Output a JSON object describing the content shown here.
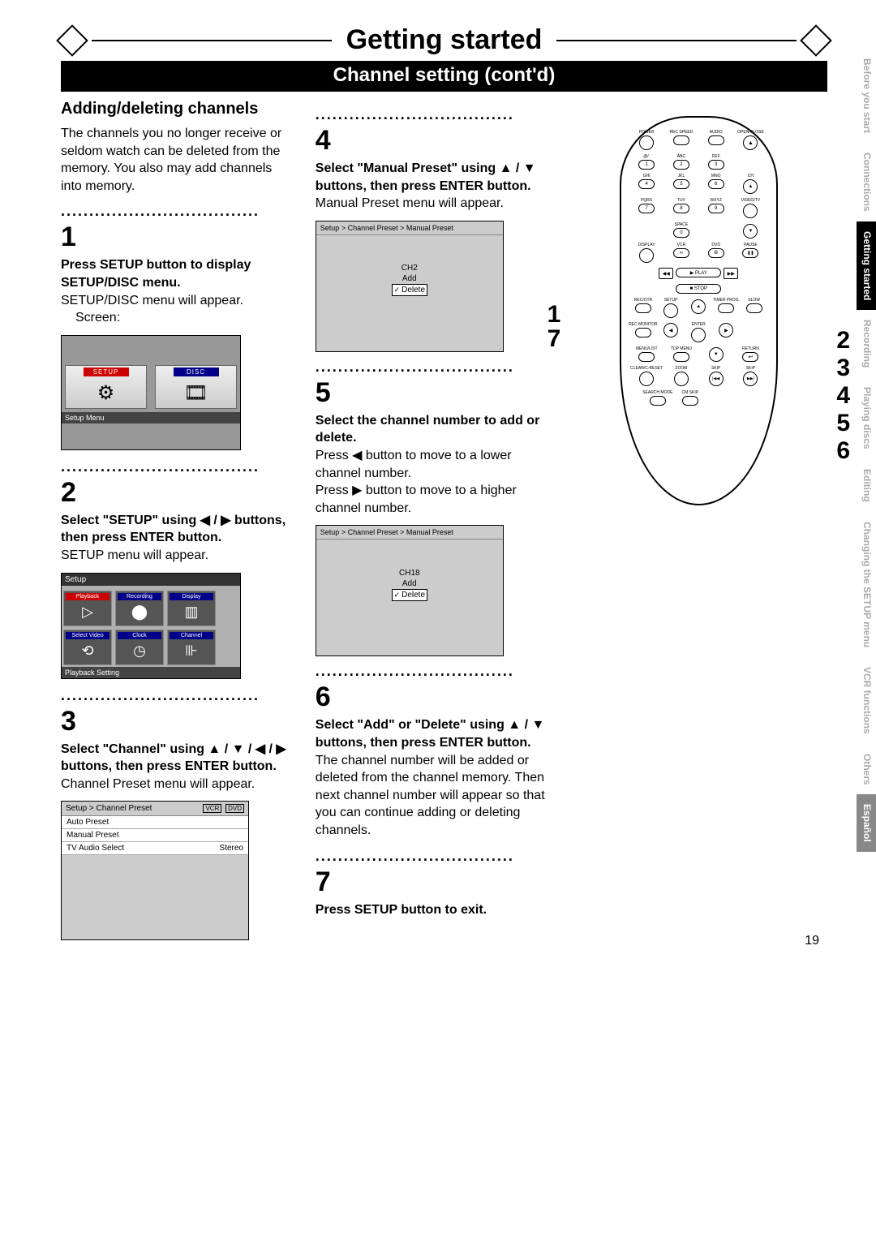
{
  "header": {
    "title": "Getting started",
    "subtitle": "Channel setting (cont'd)"
  },
  "section_heading": "Adding/deleting channels",
  "intro": "The channels you no longer receive or seldom watch can be deleted from the memory. You also may add channels into memory.",
  "dots": "...................................",
  "steps": {
    "s1": {
      "num": "1",
      "bold": "Press SETUP button to display SETUP/DISC menu.",
      "body": "SETUP/DISC menu will appear.",
      "indent": "Screen:"
    },
    "s2": {
      "num": "2",
      "bold": "Select \"SETUP\" using ◀ / ▶ buttons, then press ENTER button.",
      "body": "SETUP menu will appear."
    },
    "s3": {
      "num": "3",
      "bold": "Select \"Channel\" using ▲ / ▼ / ◀ / ▶ buttons, then press ENTER button.",
      "body": "Channel Preset menu will appear."
    },
    "s4": {
      "num": "4",
      "bold": "Select \"Manual Preset\" using ▲ / ▼ buttons, then press ENTER button.",
      "body": "Manual Preset menu will appear."
    },
    "s5": {
      "num": "5",
      "bold": "Select the channel number to add or delete.",
      "body1": "Press ◀ button to move to a lower channel number.",
      "body2": "Press ▶ button to move to a higher channel number."
    },
    "s6": {
      "num": "6",
      "bold": "Select \"Add\" or \"Delete\" using ▲ / ▼ buttons, then press ENTER button.",
      "body": "The channel number will be added or deleted from the channel memory. Then next channel number will appear so that you can continue adding or deleting channels."
    },
    "s7": {
      "num": "7",
      "bold": "Press SETUP button to exit."
    }
  },
  "screens": {
    "setup_disc": {
      "setup_label": "SETUP",
      "disc_label": "DISC",
      "footer": "Setup Menu"
    },
    "setup_menu": {
      "title": "Setup",
      "tiles": [
        "Playback",
        "Recording",
        "Display",
        "Select\nVideo",
        "Clock",
        "Channel"
      ],
      "footer": "Playback Setting"
    },
    "channel_preset": {
      "breadcrumb": "Setup > Channel Preset",
      "tags": [
        "VCR",
        "DVD"
      ],
      "rows": [
        {
          "name": "Auto Preset",
          "val": ""
        },
        {
          "name": "Manual Preset",
          "val": ""
        },
        {
          "name": "TV Audio Select",
          "val": "Stereo"
        }
      ]
    },
    "manual_preset_1": {
      "breadcrumb": "Setup > Channel Preset > Manual Preset",
      "ch": "CH2",
      "add": "Add",
      "del": "Delete"
    },
    "manual_preset_2": {
      "breadcrumb": "Setup > Channel Preset > Manual Preset",
      "ch": "CH18",
      "add": "Add",
      "del": "Delete"
    }
  },
  "remote": {
    "callouts_left": [
      "1",
      "7"
    ],
    "callouts_right": [
      "2",
      "3",
      "4",
      "5",
      "6"
    ],
    "row1": [
      "POWER",
      "REC SPEED",
      "AUDIO",
      "OPEN/CLOSE"
    ],
    "row2_lbl": [
      "@/.",
      "ABC",
      "DEF",
      ""
    ],
    "row2_num": [
      "1",
      "2",
      "3",
      ""
    ],
    "row3_lbl": [
      "GHI",
      "JKL",
      "MNO",
      "CH"
    ],
    "row3_num": [
      "4",
      "5",
      "6",
      "▲"
    ],
    "row4_lbl": [
      "PQRS",
      "TUV",
      "WXYZ",
      "VIDEO/TV"
    ],
    "row4_num": [
      "7",
      "8",
      "9",
      ""
    ],
    "row5_lbl": [
      "",
      "SPACE",
      "",
      ""
    ],
    "row5_num": [
      "",
      "0",
      "",
      "▼"
    ],
    "row6": [
      "DISPLAY",
      "VCR",
      "DVD",
      "PAUSE"
    ],
    "row6_sym": [
      "",
      "∞",
      "⦾",
      "❚❚"
    ],
    "play": "▶ PLAY",
    "rewff": [
      "◀◀",
      "▶▶"
    ],
    "stop": "■ STOP",
    "row7": [
      "REC/OTR",
      "SETUP",
      "",
      "TIMER PROG.",
      "SLOW"
    ],
    "row7b": [
      "REC MONITOR",
      "",
      "ENTER",
      "",
      ""
    ],
    "dpad": [
      "▲",
      "◀",
      "▶",
      "▼"
    ],
    "row8": [
      "MENU/LIST",
      "TOP MENU",
      "",
      "RETURN"
    ],
    "row8b": [
      "CLEAR/C-RESET",
      "ZOOM",
      "SKIP",
      "SKIP"
    ],
    "row8b_sym": [
      "",
      "",
      "|◀◀",
      "▶▶|"
    ],
    "row9": [
      "SEARCH\nMODE",
      "CM SKIP",
      "",
      ""
    ]
  },
  "tabs": [
    {
      "label": "Before you start",
      "cls": ""
    },
    {
      "label": "Connections",
      "cls": ""
    },
    {
      "label": "Getting started",
      "cls": "active"
    },
    {
      "label": "Recording",
      "cls": ""
    },
    {
      "label": "Playing discs",
      "cls": ""
    },
    {
      "label": "Editing",
      "cls": ""
    },
    {
      "label": "Changing the SETUP menu",
      "cls": ""
    },
    {
      "label": "VCR functions",
      "cls": ""
    },
    {
      "label": "Others",
      "cls": ""
    },
    {
      "label": "Español",
      "cls": "semi"
    }
  ],
  "page_number": "19"
}
